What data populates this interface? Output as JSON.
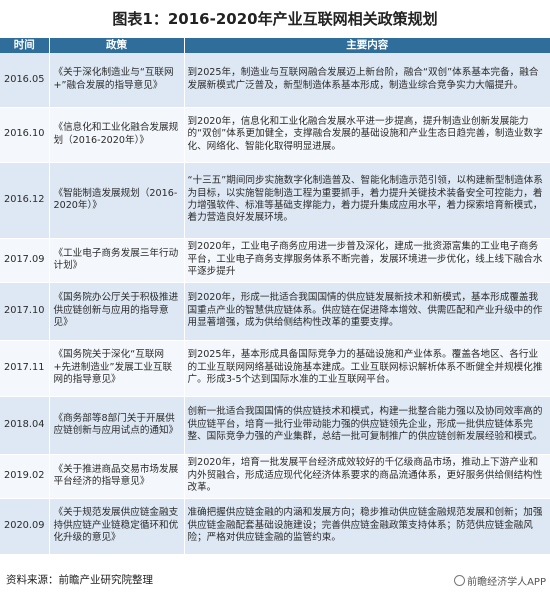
{
  "title": "图表1：2016-2020年产业互联网相关政策规划",
  "headers": [
    "时间",
    "政策",
    "主要内容"
  ],
  "rows": [
    {
      "time": "2016.05",
      "policy": "《关于深化制造业与“互联网+”融合发展的指导意见》",
      "content": "到2025年，制造业与互联网融合发展迈上新台阶，融合“双创”体系基本完备，融合发展新模式广泛普及，新型制造体系基本形成，制造业综合竞争实力大幅提升。"
    },
    {
      "time": "2016.10",
      "policy": "《信息化和工业化融合发展规划（2016-2020年）》",
      "content": "到2020年，信息化和工业化融合发展水平进一步提高，提升制造业创新发展能力的“双创”体系更加健全，支撑融合发展的基础设施和产业生态日趋完善，制造业数字化、网络化、智能化取得明显进展。"
    },
    {
      "time": "2016.12",
      "policy": "《智能制造发展规划（2016-2020年）》",
      "content": "“十三五”期间同步实施数字化制造普及、智能化制造示范引领，以构建新型制造体系为目标，以实施智能制造工程为重要抓手，着力提升关键技术装备安全可控能力，着力增强软件、标准等基础支撑能力，着力提升集成应用水平，着力探索培育新模式，着力营造良好发展环境。"
    },
    {
      "time": "2017.09",
      "policy": "《工业电子商务发展三年行动计划》",
      "content": "到2020年，工业电子商务应用进一步普及深化，建成一批资源富集的工业电子商务平台，工业电子商务支撑服务体系不断完善，发展环境进一步优化，线上线下融合水平逐步提升"
    },
    {
      "time": "2017.10",
      "policy": "《国务院办公厅关于积极推进供应链创新与应用的指导意见》",
      "content": "到2020年，形成一批适合我国国情的供应链发展新技术和新模式，基本形成覆盖我国重点产业的智慧供应链体系。供应链在促进降本增效、供需匹配和产业升级中的作用显著增强，成为供给侧结构性改革的重要支撑。"
    },
    {
      "time": "2017.11",
      "policy": "《国务院关于深化“互联网+先进制造业”发展工业互联网的指导意见》",
      "content": "到2025年，基本形成具备国际竞争力的基础设施和产业体系。覆盖各地区、各行业的工业互联网网络基础设施基本建成。工业互联网标识解析体系不断健全并规模化推广。形成3-5个达到国际水准的工业互联网平台。"
    },
    {
      "time": "2018.04",
      "policy": "《商务部等8部门关于开展供应链创新与应用试点的通知》",
      "content": "创新一批适合我国国情的供应链技术和模式，构建一批整合能力强以及协同效率高的供应链平台，培育一批行业带动能力强的供应链领先企业，形成一批供应链体系完整、国际竞争力强的产业集群，总结一批可复制推广的供应链创新发展经验和模式。"
    },
    {
      "time": "2019.02",
      "policy": "《关于推进商品交易市场发展平台经济的指导意见》",
      "content": "到2020年，培育一批发展平台经济成效较好的千亿级商品市场，推动上下游产业和内外贸融合，形成适应现代化经济体系要求的商品流通体系，更好服务供给侧结构性改革。"
    },
    {
      "time": "2020.09",
      "policy": "《关于规范发展供应链金融支持供应链产业链稳定循环和优化升级的意见》",
      "content": "准确把握供应链金融的内涵和发展方向；稳步推动供应链金融规范发展和创新；加强供应链金融配套基础设施建设；完善供应链金融政策支持体系；防范供应链金融风险；严格对供应链金融的监管约束。"
    }
  ],
  "footer": "资料来源：前瞻产业研究院整理",
  "brand": "前瞻经济学人APP"
}
